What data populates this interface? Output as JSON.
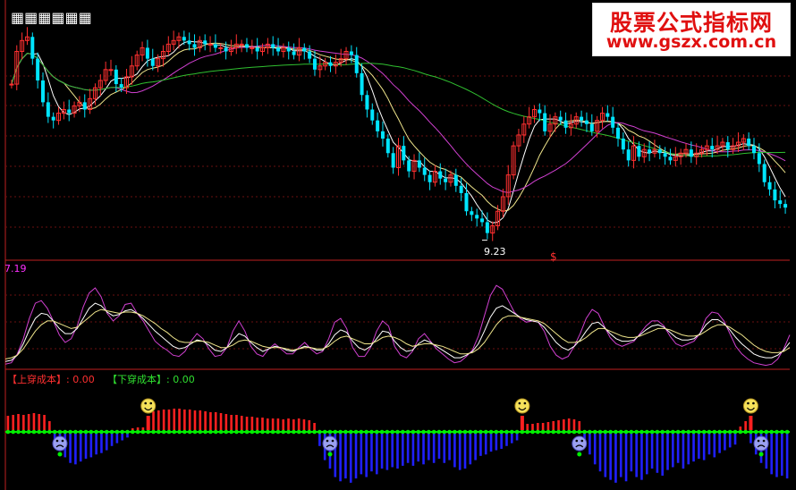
{
  "watermark": {
    "title": "股票公式指标网",
    "url": "www.gszx.com.cn"
  },
  "chart_data": [
    {
      "type": "candlestick",
      "panel": "price",
      "ylim": [
        9.0,
        12.2
      ],
      "annotations": {
        "low_label": "9.23",
        "low_index": 91,
        "marker_text": "$"
      },
      "colors": {
        "up": "#ff3030",
        "down": "#00e5ff",
        "ma5": "#ffffff",
        "ma10": "#f0e68c",
        "ma20": "#d040d0",
        "ma60": "#30c030"
      },
      "close": [
        11.35,
        11.8,
        11.95,
        12.0,
        11.7,
        11.4,
        11.1,
        10.9,
        10.85,
        10.95,
        11.0,
        10.95,
        11.05,
        11.1,
        11.0,
        11.15,
        11.3,
        11.4,
        11.55,
        11.55,
        11.35,
        11.3,
        11.45,
        11.6,
        11.75,
        11.85,
        11.7,
        11.6,
        11.7,
        11.8,
        11.9,
        11.95,
        12.0,
        11.95,
        11.9,
        11.85,
        11.95,
        11.9,
        11.9,
        11.85,
        11.85,
        11.8,
        11.85,
        11.9,
        11.9,
        11.85,
        11.85,
        11.8,
        11.85,
        11.9,
        11.85,
        11.8,
        11.85,
        11.8,
        11.75,
        11.85,
        11.8,
        11.7,
        11.55,
        11.6,
        11.65,
        11.6,
        11.65,
        11.7,
        11.8,
        11.75,
        11.5,
        11.2,
        11.0,
        10.85,
        10.7,
        10.6,
        10.4,
        10.2,
        10.5,
        10.3,
        10.15,
        10.3,
        10.2,
        10.1,
        10.0,
        10.15,
        10.05,
        10.0,
        10.1,
        9.95,
        9.85,
        9.6,
        9.55,
        9.5,
        9.45,
        9.3,
        9.4,
        9.6,
        9.8,
        10.1,
        10.5,
        10.65,
        10.8,
        10.9,
        11.0,
        10.95,
        10.7,
        10.8,
        10.9,
        10.85,
        10.75,
        10.8,
        10.9,
        10.85,
        10.8,
        10.7,
        10.85,
        10.95,
        10.9,
        10.75,
        10.6,
        10.45,
        10.3,
        10.5,
        10.35,
        10.45,
        10.4,
        10.45,
        10.4,
        10.35,
        10.3,
        10.35,
        10.4,
        10.45,
        10.35,
        10.4,
        10.45,
        10.5,
        10.45,
        10.5,
        10.55,
        10.45,
        10.5,
        10.55,
        10.6,
        10.5,
        10.4,
        10.25,
        10.0,
        9.9,
        9.75,
        9.7,
        9.65
      ],
      "ma_periods": [
        5,
        10,
        20,
        60
      ]
    },
    {
      "type": "line",
      "panel": "oscillator",
      "top_value_label": "7.19",
      "series": [
        {
          "color": "#d040d0",
          "values": [
            0.2,
            0.3,
            1.0,
            2.2,
            3.8,
            5.0,
            5.2,
            4.6,
            3.6,
            2.5,
            1.9,
            2.2,
            3.2,
            4.7,
            5.8,
            6.2,
            5.5,
            4.2,
            3.6,
            4.0,
            4.9,
            5.0,
            4.2,
            3.6,
            2.8,
            2.0,
            1.6,
            1.3,
            0.9,
            0.8,
            1.2,
            2.0,
            2.6,
            2.2,
            1.4,
            0.8,
            0.9,
            1.5,
            2.8,
            3.6,
            2.8,
            1.6,
            1.0,
            0.8,
            1.4,
            1.8,
            1.4,
            1.0,
            1.0,
            1.5,
            1.9,
            1.4,
            1.0,
            1.2,
            2.2,
            3.5,
            3.8,
            3.0,
            1.5,
            0.8,
            0.8,
            1.5,
            2.8,
            3.6,
            3.2,
            1.6,
            0.9,
            0.7,
            1.2,
            2.2,
            2.6,
            2.0,
            1.4,
            1.0,
            0.6,
            0.3,
            0.4,
            0.8,
            1.3,
            2.4,
            4.0,
            5.6,
            6.4,
            6.1,
            5.2,
            4.3,
            3.8,
            3.5,
            3.6,
            3.5,
            2.8,
            1.6,
            0.9,
            0.6,
            0.8,
            1.6,
            2.6,
            3.8,
            4.5,
            4.2,
            3.2,
            2.3,
            1.8,
            1.6,
            1.8,
            2.0,
            2.6,
            3.2,
            3.6,
            3.6,
            3.2,
            2.4,
            1.8,
            1.6,
            1.8,
            2.0,
            2.6,
            3.8,
            4.3,
            4.2,
            3.6,
            2.6,
            1.6,
            1.0,
            0.6,
            0.3,
            0.2,
            0.1,
            0.2,
            0.6,
            1.4,
            2.5
          ]
        },
        {
          "color": "#ffffff",
          "values": [
            0.4,
            0.5,
            0.9,
            1.8,
            2.9,
            3.8,
            4.2,
            4.1,
            3.6,
            3.0,
            2.6,
            2.6,
            3.0,
            3.8,
            4.6,
            5.0,
            4.8,
            4.3,
            4.0,
            4.1,
            4.4,
            4.5,
            4.2,
            3.8,
            3.3,
            2.8,
            2.4,
            2.0,
            1.6,
            1.4,
            1.5,
            1.8,
            2.1,
            2.0,
            1.7,
            1.3,
            1.2,
            1.5,
            2.1,
            2.6,
            2.4,
            1.9,
            1.5,
            1.2,
            1.4,
            1.6,
            1.5,
            1.3,
            1.2,
            1.4,
            1.6,
            1.5,
            1.3,
            1.3,
            1.8,
            2.5,
            2.9,
            2.7,
            2.0,
            1.5,
            1.3,
            1.6,
            2.2,
            2.8,
            2.7,
            2.0,
            1.5,
            1.2,
            1.3,
            1.8,
            2.1,
            1.9,
            1.6,
            1.3,
            1.0,
            0.7,
            0.7,
            0.9,
            1.2,
            1.8,
            2.8,
            3.9,
            4.6,
            4.8,
            4.5,
            4.2,
            3.9,
            3.7,
            3.6,
            3.5,
            3.1,
            2.5,
            1.9,
            1.5,
            1.3,
            1.6,
            2.1,
            2.8,
            3.4,
            3.5,
            3.1,
            2.6,
            2.2,
            2.0,
            2.0,
            2.1,
            2.5,
            2.9,
            3.2,
            3.3,
            3.1,
            2.7,
            2.3,
            2.1,
            2.1,
            2.2,
            2.6,
            3.3,
            3.7,
            3.7,
            3.4,
            2.9,
            2.3,
            1.8,
            1.4,
            1.0,
            0.8,
            0.7,
            0.7,
            0.9,
            1.3,
            1.9
          ]
        },
        {
          "color": "#f0e68c",
          "values": [
            0.6,
            0.7,
            0.9,
            1.4,
            2.1,
            2.8,
            3.3,
            3.6,
            3.6,
            3.4,
            3.2,
            3.0,
            3.1,
            3.5,
            3.9,
            4.3,
            4.5,
            4.4,
            4.3,
            4.2,
            4.3,
            4.3,
            4.2,
            4.0,
            3.7,
            3.4,
            3.0,
            2.7,
            2.3,
            2.0,
            1.9,
            1.9,
            2.0,
            2.0,
            1.9,
            1.7,
            1.5,
            1.5,
            1.7,
            2.0,
            2.1,
            2.0,
            1.8,
            1.6,
            1.5,
            1.5,
            1.5,
            1.4,
            1.3,
            1.4,
            1.5,
            1.5,
            1.4,
            1.4,
            1.6,
            2.0,
            2.3,
            2.4,
            2.2,
            2.0,
            1.8,
            1.8,
            2.0,
            2.3,
            2.4,
            2.3,
            2.1,
            1.8,
            1.6,
            1.7,
            1.8,
            1.8,
            1.7,
            1.6,
            1.4,
            1.2,
            1.0,
            1.0,
            1.1,
            1.4,
            1.9,
            2.6,
            3.3,
            3.8,
            4.0,
            4.0,
            3.9,
            3.8,
            3.7,
            3.6,
            3.4,
            3.0,
            2.6,
            2.2,
            1.9,
            1.9,
            2.0,
            2.3,
            2.7,
            3.0,
            3.0,
            2.8,
            2.6,
            2.4,
            2.3,
            2.3,
            2.4,
            2.6,
            2.8,
            3.0,
            3.0,
            2.9,
            2.7,
            2.5,
            2.4,
            2.4,
            2.5,
            2.8,
            3.1,
            3.3,
            3.3,
            3.1,
            2.8,
            2.5,
            2.1,
            1.7,
            1.4,
            1.2,
            1.1,
            1.1,
            1.2,
            1.5
          ]
        }
      ],
      "ylim": [
        0,
        7.4
      ]
    },
    {
      "type": "bar",
      "panel": "cost-cross",
      "labels": {
        "up_cross": "【上穿成本】: 0.00",
        "down_cross": "【下穿成本】: 0.00"
      },
      "colors": {
        "positive": "#ff2020",
        "negative": "#2020ff",
        "baseline": "#00ee00"
      },
      "values": [
        1.8,
        1.9,
        2.0,
        1.9,
        2.0,
        2.1,
        2.0,
        1.9,
        1.2,
        -1.0,
        -1.3,
        -1.8,
        -2.2,
        -2.3,
        -2.1,
        -1.9,
        -1.8,
        -1.6,
        -1.5,
        -1.3,
        -1.0,
        -0.8,
        -0.6,
        -0.4,
        0.4,
        0.5,
        0.5,
        1.6,
        2.3,
        2.4,
        2.5,
        2.5,
        2.6,
        2.6,
        2.5,
        2.5,
        2.4,
        2.4,
        2.3,
        2.2,
        2.2,
        2.1,
        2.0,
        1.9,
        1.9,
        1.8,
        1.7,
        1.7,
        1.6,
        1.6,
        1.5,
        1.5,
        1.5,
        1.4,
        1.5,
        1.4,
        1.5,
        1.4,
        1.3,
        1.0,
        -1.0,
        -2.0,
        -2.6,
        -3.2,
        -3.5,
        -3.3,
        -3.6,
        -3.3,
        -3.0,
        -3.2,
        -2.8,
        -3.0,
        -2.6,
        -2.7,
        -2.5,
        -2.6,
        -2.4,
        -2.2,
        -2.4,
        -2.1,
        -2.3,
        -2.0,
        -2.2,
        -1.9,
        -2.2,
        -2.0,
        -2.5,
        -2.7,
        -2.6,
        -2.3,
        -2.0,
        -1.7,
        -1.6,
        -1.4,
        -1.3,
        -1.2,
        -1.0,
        -0.8,
        -0.6,
        0.4,
        0.9,
        0.9,
        1.0,
        1.0,
        1.1,
        1.2,
        1.3,
        1.4,
        1.5,
        1.4,
        1.2,
        -0.9,
        -1.6,
        -2.3,
        -2.8,
        -3.2,
        -3.4,
        -3.6,
        -3.2,
        -3.5,
        -2.8,
        -3.2,
        -3.4,
        -3.0,
        -2.6,
        -2.9,
        -3.1,
        -2.7,
        -2.5,
        -2.2,
        -2.6,
        -2.3,
        -2.1,
        -1.9,
        -2.0,
        -1.6,
        -1.8,
        -1.5,
        -1.3,
        -1.1,
        -0.9,
        0.6,
        1.2,
        -0.8,
        -1.6,
        -2.2,
        -2.6,
        -3.0,
        -3.2,
        -3.1,
        -3.3
      ],
      "ylim": [
        -3.8,
        3.0
      ],
      "signals": [
        {
          "kind": "smile-icon",
          "index": 27
        },
        {
          "kind": "smile-icon",
          "index": 99
        },
        {
          "kind": "smile-icon",
          "index": 143
        },
        {
          "kind": "frown-icon",
          "index": 10
        },
        {
          "kind": "frown-icon",
          "index": 62
        },
        {
          "kind": "frown-icon",
          "index": 110
        },
        {
          "kind": "frown-icon",
          "index": 145
        }
      ]
    }
  ]
}
